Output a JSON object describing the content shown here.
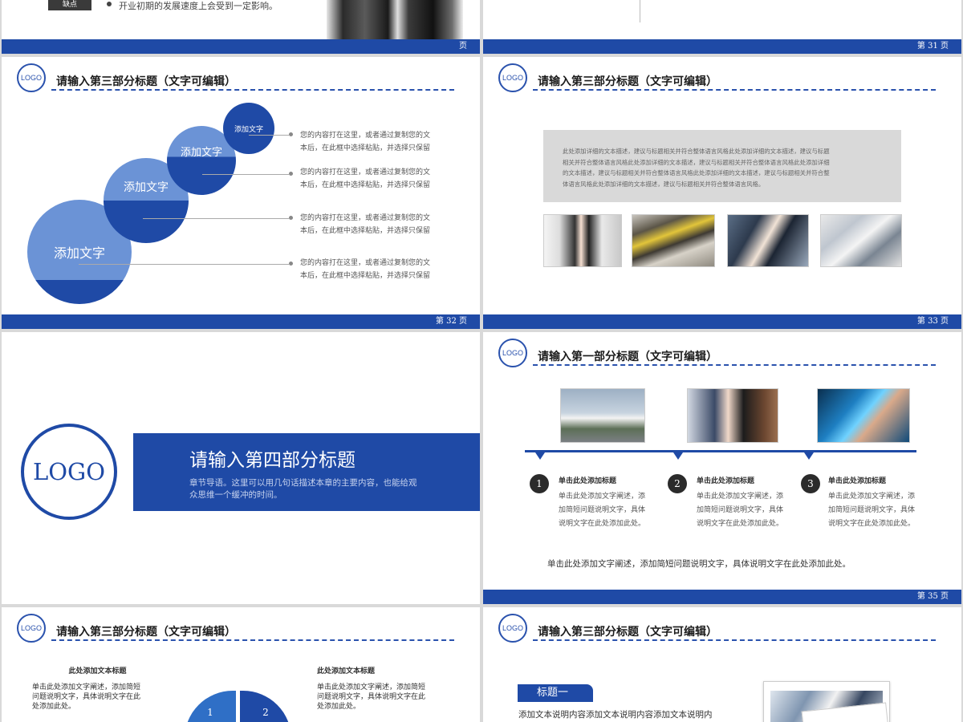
{
  "slides": {
    "s30": {
      "tag": "缺点",
      "text": "开业初期的发展速度上会受到一定影响。",
      "page": "页"
    },
    "s31": {
      "page": "第 31 页"
    },
    "s32": {
      "logo": "LOGO",
      "title": "请输入第三部分标题（文字可编辑）",
      "circles": [
        "添加文字",
        "添加文字",
        "添加文字",
        "添加文字"
      ],
      "desc": [
        [
          "您的内容打在这里，或者通过复制您的文",
          "本后，在此框中选择粘贴，并选择只保留"
        ],
        [
          "您的内容打在这里，或者通过复制您的文",
          "本后，在此框中选择粘贴，并选择只保留"
        ],
        [
          "您的内容打在这里，或者通过复制您的文",
          "本后，在此框中选择粘贴，并选择只保留"
        ],
        [
          "您的内容打在这里，或者通过复制您的文",
          "本后，在此框中选择粘贴，并选择只保留"
        ]
      ],
      "page": "第 32 页"
    },
    "s33": {
      "logo": "LOGO",
      "title": "请输入第三部分标题（文字可编辑）",
      "box": [
        "此处添加详细的文本描述，建议与标题相关并符合整体语言风格此处添加详细的文本描述，建议与标题",
        "相关并符合整体语言风格此处添加详细的文本描述，建议与标题相关并符合整体语言风格此处添加详细",
        "的文本描述，建议与标题相关并符合整体语言风格此处添加详细的文本描述，建议与标题相关并符合整",
        "体语言风格此处添加详细的文本描述，建议与标题相关并符合整体语言风格。"
      ],
      "page": "第 33 页"
    },
    "s34": {
      "logo": "LOGO",
      "title": "请输入第四部分标题",
      "sub": [
        "章节导语。这里可以用几句话描述本章的主要内容，也能给观",
        "众思维一个缓冲的时间。"
      ]
    },
    "s35": {
      "logo": "LOGO",
      "title": "请输入第一部分标题（文字可编辑）",
      "items": [
        {
          "num": "1",
          "head": "单击此处添加标题",
          "body": [
            "单击此处添加文字阐述，添",
            "加简短问题说明文字，具体",
            "说明文字在此处添加此处。"
          ]
        },
        {
          "num": "2",
          "head": "单击此处添加标题",
          "body": [
            "单击此处添加文字阐述，添",
            "加简短问题说明文字，具体",
            "说明文字在此处添加此处。"
          ]
        },
        {
          "num": "3",
          "head": "单击此处添加标题",
          "body": [
            "单击此处添加文字阐述，添",
            "加简短问题说明文字，具体",
            "说明文字在此处添加此处。"
          ]
        }
      ],
      "bottom": "单击此处添加文字阐述，添加简短问题说明文字，具体说明文字在此处添加此处。",
      "page": "第 35 页"
    },
    "s36": {
      "logo": "LOGO",
      "title": "请输入第三部分标题（文字可编辑）",
      "left_head": "此处添加文本标题",
      "left_body": [
        "单击此处添加文字阐述，添加简短",
        "问题说明文字，具体说明文字在此",
        "处添加此处。"
      ],
      "right_head": "此处添加文本标题",
      "right_body": [
        "单击此处添加文字阐述，添加简短",
        "问题说明文字，具体说明文字在此",
        "处添加此处。"
      ],
      "seg": [
        "1",
        "2"
      ]
    },
    "s37": {
      "logo": "LOGO",
      "title": "请输入第三部分标题（文字可编辑）",
      "tag": "标题一",
      "text": "添加文本说明内容添加文本说明内容添加文本说明内"
    }
  }
}
